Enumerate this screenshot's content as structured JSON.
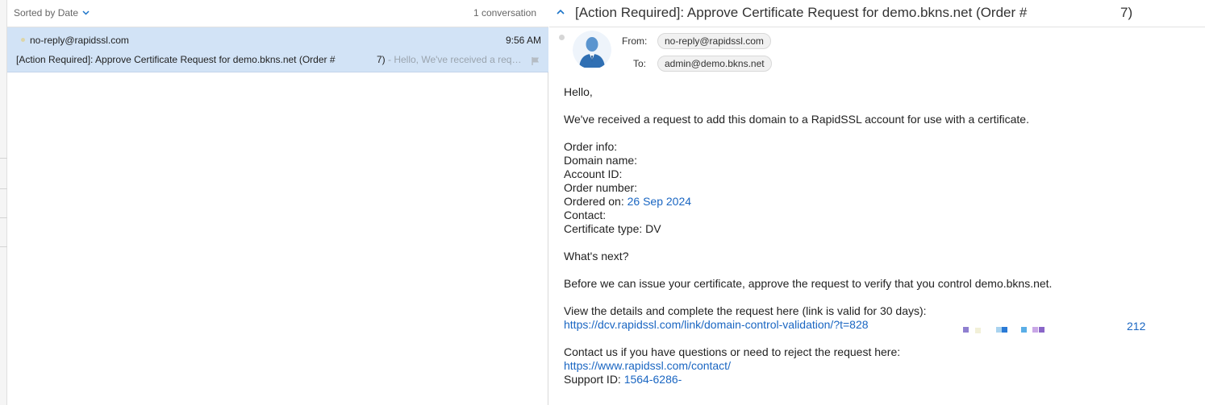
{
  "list": {
    "sort_label": "Sorted by Date",
    "conversation_count": "1 conversation",
    "message": {
      "sender": "no-reply@rapidssl.com",
      "time": "9:56 AM",
      "subject": "[Action Required]: Approve Certificate Request for demo.bkns.net (Order #",
      "subject_tail": "7)",
      "preview": " - Hello, We've received a request to add this domain to a RapidSSL account"
    }
  },
  "reader": {
    "subject": "[Action Required]: Approve Certificate Request for demo.bkns.net (Order #",
    "subject_tail": "7)",
    "from_label": "From:",
    "to_label": "To:",
    "from": "no-reply@rapidssl.com",
    "to": "admin@demo.bkns.net",
    "body": {
      "greeting": "Hello,",
      "intro": "We've received a request to add this domain to a RapidSSL account for use with a certificate.",
      "order_info": "Order info:",
      "domain_name": "Domain name:",
      "account_id": "Account ID:",
      "order_number": "Order number:",
      "ordered_on_label": "Ordered on: ",
      "ordered_on_value": "26 Sep 2024",
      "contact": "Contact:",
      "cert_type": "Certificate type: DV",
      "whats_next": "What's next?",
      "before_issue": "Before we can issue your certificate, approve the request to verify that you control demo.bkns.net.",
      "view_details": "View the details and complete the request here (link is valid for 30 days):",
      "dcv_link": "https://dcv.rapidssl.com/link/domain-control-validation/?t=828",
      "dcv_link_tail": "212",
      "contact_us": "Contact us if you have questions or need to reject the request here:",
      "contact_link": "https://www.rapidssl.com/contact/",
      "support_label": "Support ID: ",
      "support_value": "1564-6286-"
    }
  },
  "colors": {
    "selected_row": "#d2e3f6",
    "link": "#1a66c2",
    "accent": "#1a73c8"
  }
}
